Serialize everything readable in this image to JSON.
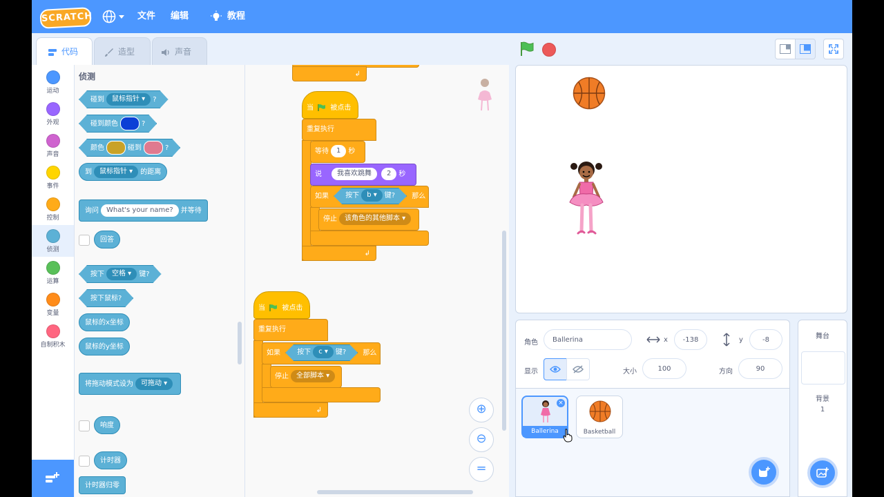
{
  "menu": {
    "logo": "SCRATCH",
    "file": "文件",
    "edit": "编辑",
    "tutorials": "教程"
  },
  "tabs": [
    {
      "label": "代码"
    },
    {
      "label": "造型"
    },
    {
      "label": "声音"
    }
  ],
  "categories": [
    {
      "label": "运动",
      "color": "#4c97ff"
    },
    {
      "label": "外观",
      "color": "#9966ff"
    },
    {
      "label": "声音",
      "color": "#cf63cf"
    },
    {
      "label": "事件",
      "color": "#ffd500"
    },
    {
      "label": "控制",
      "color": "#ffab19"
    },
    {
      "label": "侦测",
      "color": "#5cb1d6"
    },
    {
      "label": "运算",
      "color": "#59c059"
    },
    {
      "label": "变量",
      "color": "#ff8c1a"
    },
    {
      "label": "自制积木",
      "color": "#ff6680"
    }
  ],
  "palette": {
    "title": "侦测",
    "touching": "碰到",
    "mouse_pointer": "鼠标指针",
    "question": "?",
    "touching_color": "碰到颜色",
    "color": "颜色",
    "touch": "碰到",
    "distance_to": "到",
    "distance": "的距离",
    "ask": "询问",
    "ask_default": "What's your name?",
    "and_wait": "并等待",
    "answer": "回答",
    "key_pressed": "按下",
    "space": "空格",
    "key": "键?",
    "mouse_down": "按下鼠标?",
    "mouse_x": "鼠标的x坐标",
    "mouse_y": "鼠标的y坐标",
    "set_drag": "将拖动模式设为",
    "draggable": "可拖动",
    "loudness": "响度",
    "timer": "计时器",
    "reset_timer": "计时器归零",
    "swatch_blue": "#0b3fd6",
    "swatch_gold": "#c9a227",
    "swatch_pink": "#e07a8f"
  },
  "script": {
    "when": "当",
    "clicked": "被点击",
    "forever": "重复执行",
    "wait": "等待",
    "wait_value": "1",
    "seconds": "秒",
    "say": "说",
    "say_text": "我喜欢跳舞",
    "say_secs": "2",
    "if": "如果",
    "then": "那么",
    "key_pressed": "按下",
    "key_b": "b",
    "key_c": "c",
    "key_q": "键?",
    "stop": "停止",
    "other_scripts": "该角色的其他脚本",
    "all_scripts": "全部脚本",
    "zoom_in": "⊕",
    "zoom_out": "⊖",
    "zoom_reset": "="
  },
  "sprite_info": {
    "sprite_label": "角色",
    "sprite_name": "Ballerina",
    "x_label": "x",
    "x_value": "-138",
    "y_label": "y",
    "y_value": "-8",
    "show_label": "显示",
    "size_label": "大小",
    "size_value": "100",
    "direction_label": "方向",
    "direction_value": "90"
  },
  "sprites": [
    {
      "name": "Ballerina"
    },
    {
      "name": "Basketball"
    }
  ],
  "stage_pane": {
    "title": "舞台",
    "backdrops_label": "背景",
    "backdrops_count": "1"
  }
}
